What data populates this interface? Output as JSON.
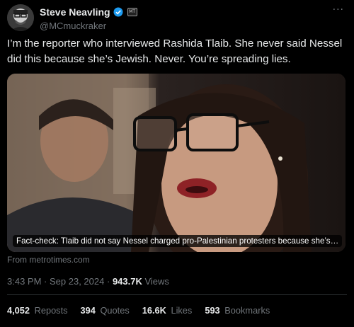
{
  "author": {
    "display_name": "Steve Neavling",
    "handle": "@MCmuckraker",
    "verified_icon": "verified-badge-icon",
    "affiliation_badge": "affiliation-badge-icon"
  },
  "more_label": "···",
  "tweet": {
    "text": "I’m the reporter who interviewed Rashida Tlaib. She never said Nessel did this because she’s Jewish. Never. You’re spreading lies."
  },
  "media": {
    "caption": "Fact-check: Tlaib did not say Nessel charged pro-Palestinian protesters because she’s…",
    "source": "From metrotimes.com"
  },
  "meta": {
    "time": "3:43 PM",
    "date": "Sep 23, 2024",
    "views_count": "943.7K",
    "views_label": "Views"
  },
  "stats": {
    "reposts_count": "4,052",
    "reposts_label": "Reposts",
    "quotes_count": "394",
    "quotes_label": "Quotes",
    "likes_count": "16.6K",
    "likes_label": "Likes",
    "bookmarks_count": "593",
    "bookmarks_label": "Bookmarks"
  },
  "colors": {
    "background": "#000000",
    "text_primary": "#e7e9ea",
    "text_secondary": "#71767b",
    "verified_blue": "#1d9bf0",
    "divider": "#2f3336"
  }
}
